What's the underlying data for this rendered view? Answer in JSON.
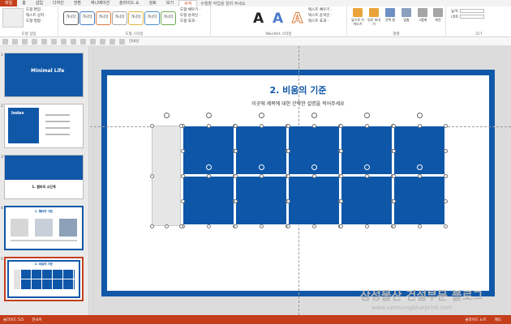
{
  "tabs": [
    {
      "label": "파일",
      "active": false,
      "file": true
    },
    {
      "label": "홈",
      "active": false
    },
    {
      "label": "삽입",
      "active": false
    },
    {
      "label": "디자인",
      "active": false
    },
    {
      "label": "전환",
      "active": false
    },
    {
      "label": "애니메이션",
      "active": false
    },
    {
      "label": "슬라이드 쇼",
      "active": false
    },
    {
      "label": "검토",
      "active": false
    },
    {
      "label": "보기",
      "active": false
    },
    {
      "label": "서식",
      "active": true
    }
  ],
  "tell_me": "수행할 작업을 알려 주세요",
  "ribbon": {
    "insert_shapes": {
      "items": [
        "도형 편집 ·",
        "텍스트 상자 ·",
        "도형 병합 ·"
      ],
      "label": "도형 삽입"
    },
    "shape_styles": {
      "boxes": [
        "가나다",
        "가나다",
        "가나다",
        "가나다",
        "가나다",
        "가나다",
        "가나다"
      ],
      "items": [
        "도형 채우기 ·",
        "도형 윤곽선 ·",
        "도형 효과 ·"
      ],
      "label": "도형 스타일"
    },
    "wordart": {
      "letters": [
        "A",
        "A",
        "A"
      ],
      "items": [
        "텍스트 채우기 ·",
        "텍스트 윤곽선 ·",
        "텍스트 효과 ·"
      ],
      "label": "WordArt 스타일"
    },
    "arrange": {
      "buttons": [
        "앞으로 가져오기",
        "뒤로 보내기",
        "선택 창",
        "맞춤",
        "그룹화",
        "회전"
      ],
      "label": "정렬"
    },
    "size": {
      "items": [
        "높이:",
        "너비:"
      ],
      "label": "크기"
    }
  },
  "qat": {
    "extra": "안내선"
  },
  "thumbs": {
    "numbers": [
      "1",
      "2",
      "3",
      "4",
      "5"
    ],
    "slide1_title": "Minimal Life",
    "slide2_title": "Index",
    "slide3_title": "1. 챕터의 소단계",
    "slide4_title": "1. 챕터의 기준",
    "slide5_title": "2. 비움의 기준"
  },
  "slide": {
    "title": "2. 비움의 기준",
    "subtitle": "이곳에 제목에 대한 간략한 설명을 적어주세요"
  },
  "status": {
    "slide_info": "슬라이드 5/5",
    "language": "한국어",
    "notes": "슬라이드 노트",
    "comments": "메모"
  },
  "watermark": {
    "line1": "삼성물산 건설부문 블로그",
    "line2": "www.samsungblueprint.com"
  },
  "colors": {
    "accent": "#c43e1c",
    "slide_blue": "#1057a8"
  }
}
